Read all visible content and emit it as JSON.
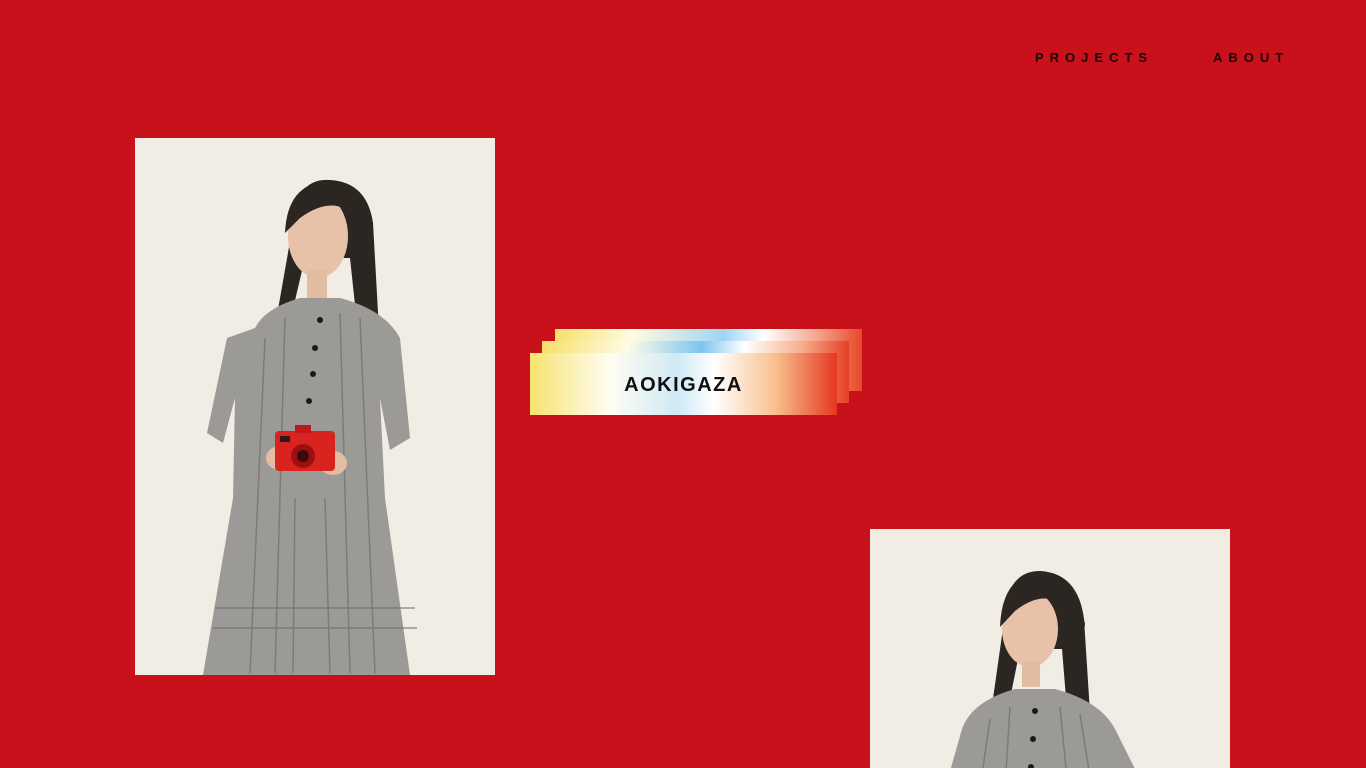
{
  "nav": {
    "projects_label": "PROJECTS",
    "about_label": "ABOUT"
  },
  "hero": {
    "title": "AOKIGAZA"
  },
  "colors": {
    "background": "#c8111a",
    "photo_backdrop": "#f1ede5",
    "text": "#1a0808"
  }
}
